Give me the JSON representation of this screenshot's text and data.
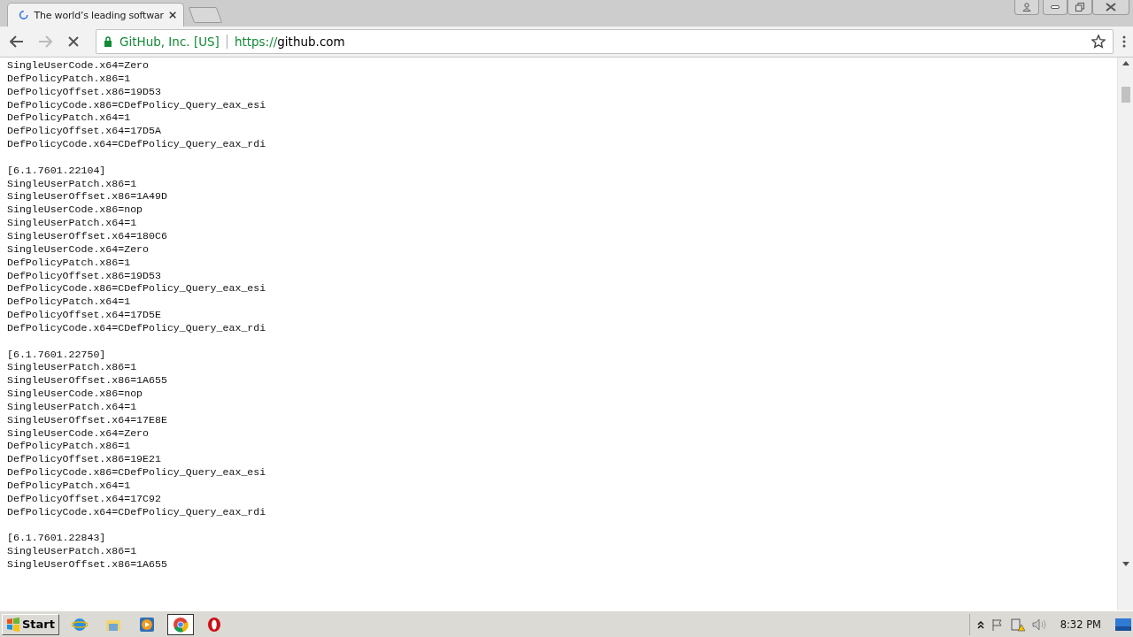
{
  "browser": {
    "tab": {
      "title": "The world’s leading softwar",
      "loading": true
    },
    "address": {
      "owner": "GitHub, Inc. [US]",
      "scheme": "https://",
      "host": "github.com"
    }
  },
  "document": {
    "sections": [
      {
        "lines": [
          "SingleUserCode.x64=Zero",
          "DefPolicyPatch.x86=1",
          "DefPolicyOffset.x86=19D53",
          "DefPolicyCode.x86=CDefPolicy_Query_eax_esi",
          "DefPolicyPatch.x64=1",
          "DefPolicyOffset.x64=17D5A",
          "DefPolicyCode.x64=CDefPolicy_Query_eax_rdi"
        ]
      },
      {
        "header": "[6.1.7601.22104]",
        "lines": [
          "SingleUserPatch.x86=1",
          "SingleUserOffset.x86=1A49D",
          "SingleUserCode.x86=nop",
          "SingleUserPatch.x64=1",
          "SingleUserOffset.x64=180C6",
          "SingleUserCode.x64=Zero",
          "DefPolicyPatch.x86=1",
          "DefPolicyOffset.x86=19D53",
          "DefPolicyCode.x86=CDefPolicy_Query_eax_esi",
          "DefPolicyPatch.x64=1",
          "DefPolicyOffset.x64=17D5E",
          "DefPolicyCode.x64=CDefPolicy_Query_eax_rdi"
        ]
      },
      {
        "header": "[6.1.7601.22750]",
        "lines": [
          "SingleUserPatch.x86=1",
          "SingleUserOffset.x86=1A655",
          "SingleUserCode.x86=nop",
          "SingleUserPatch.x64=1",
          "SingleUserOffset.x64=17E8E",
          "SingleUserCode.x64=Zero",
          "DefPolicyPatch.x86=1",
          "DefPolicyOffset.x86=19E21",
          "DefPolicyCode.x86=CDefPolicy_Query_eax_esi",
          "DefPolicyPatch.x64=1",
          "DefPolicyOffset.x64=17C92",
          "DefPolicyCode.x64=CDefPolicy_Query_eax_rdi"
        ]
      },
      {
        "header": "[6.1.7601.22843]",
        "lines": [
          "SingleUserPatch.x86=1",
          "SingleUserOffset.x86=1A655"
        ]
      }
    ]
  },
  "taskbar": {
    "start": "Start",
    "apps": [
      {
        "kind": "ie",
        "selected": false
      },
      {
        "kind": "explorer",
        "selected": false
      },
      {
        "kind": "media",
        "selected": false
      },
      {
        "kind": "chrome",
        "selected": true
      },
      {
        "kind": "opera",
        "selected": false
      }
    ],
    "clock": "8:32 PM"
  }
}
